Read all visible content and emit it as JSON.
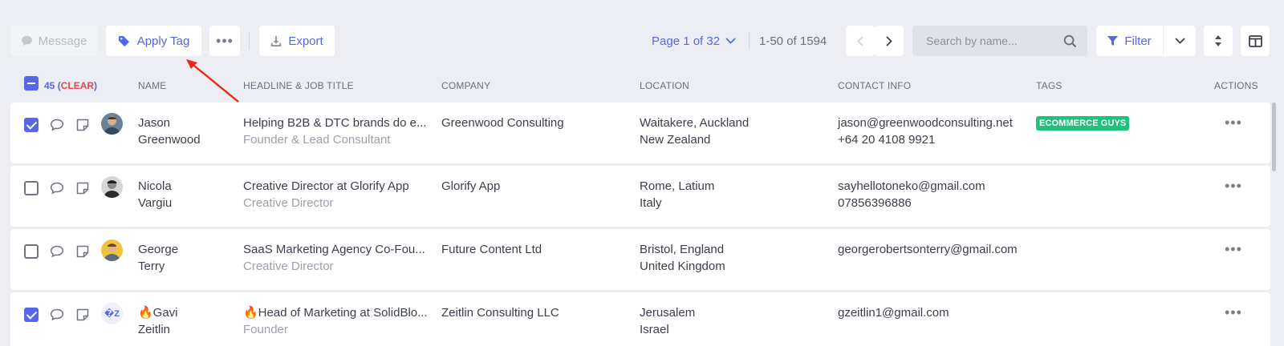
{
  "toolbar": {
    "message_label": "Message",
    "apply_tag_label": "Apply Tag",
    "more_label": "•••",
    "export_label": "Export",
    "page_label": "Page 1 of 32",
    "range_label": "1-50 of 1594",
    "search_placeholder": "Search by name...",
    "filter_label": "Filter"
  },
  "selection": {
    "count": "45",
    "clear_label": "CLEAR"
  },
  "columns": {
    "name": "NAME",
    "headline": "HEADLINE & JOB TITLE",
    "company": "COMPANY",
    "location": "LOCATION",
    "contact": "CONTACT INFO",
    "tags": "TAGS",
    "actions": "ACTIONS"
  },
  "rows": [
    {
      "checked": true,
      "first": "Jason",
      "last": "Greenwood",
      "headline": "Helping B2B & DTC brands do e...",
      "title": "Founder & Lead Consultant",
      "company": "Greenwood Consulting",
      "loc1": "Waitakere, Auckland",
      "loc2": "New Zealand",
      "email": "jason@greenwoodconsulting.net",
      "phone": "+64 20 4108 9921",
      "tag": "ECOMMERCE GUYS",
      "dots": "•••"
    },
    {
      "checked": false,
      "first": "Nicola",
      "last": "Vargiu",
      "headline": "Creative Director at Glorify App",
      "title": "Creative Director",
      "company": "Glorify App",
      "loc1": "Rome, Latium",
      "loc2": "Italy",
      "email": "sayhellotoneko@gmail.com",
      "phone": "07856396886",
      "tag": "",
      "dots": "•••"
    },
    {
      "checked": false,
      "first": "George",
      "last": "Terry",
      "headline": "SaaS Marketing Agency Co-Fou...",
      "title": "Creative Director",
      "company": "Future Content Ltd",
      "loc1": "Bristol, England",
      "loc2": "United Kingdom",
      "email": "georgerobertsonterry@gmail.com",
      "phone": "",
      "tag": "",
      "dots": "•••"
    },
    {
      "checked": true,
      "first": "🔥Gavi",
      "last": "Zeitlin",
      "headline": "🔥Head of Marketing at SolidBlo...",
      "title": "Founder",
      "company": "Zeitlin Consulting LLC",
      "loc1": "Jerusalem",
      "loc2": "Israel",
      "email": "gzeitlin1@gmail.com",
      "phone": "",
      "tag": "",
      "avatar_text": "�Z",
      "dots": "•••"
    }
  ],
  "colors": {
    "accent": "#5566e8",
    "tag_green": "#1ec27a",
    "clear_red": "#e54848",
    "annotation_arrow": "#e8281f"
  }
}
